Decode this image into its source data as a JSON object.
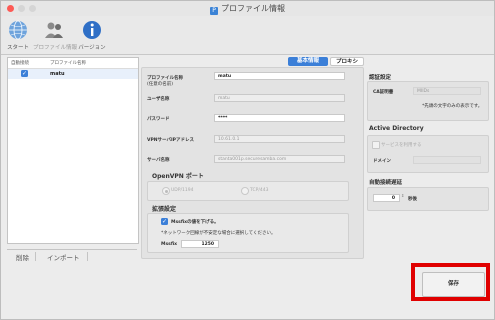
{
  "window": {
    "title": "プロファイル情報",
    "app_icon_glyph": "P",
    "traffic_lights": [
      "#fd5a55",
      "#d5d5d5",
      "#d5d5d5"
    ]
  },
  "toolbar": {
    "items": [
      {
        "label": "スタート",
        "icon": "globe-icon",
        "disabled": false
      },
      {
        "label": "プロファイル情報",
        "icon": "users-icon",
        "disabled": true
      },
      {
        "label": "バージョン",
        "icon": "info-icon",
        "disabled": false
      }
    ]
  },
  "profile_list": {
    "headers": {
      "default": "自動接続",
      "name": "プロファイル名称"
    },
    "rows": [
      {
        "default_checked": true,
        "name": "matu"
      }
    ]
  },
  "list_buttons": {
    "delete": "削除",
    "import": "インポート"
  },
  "tabs": {
    "basic": "基本情報",
    "proxy": "プロキシ",
    "active": "basic"
  },
  "form": {
    "profile_name": {
      "label": "プロファイル名称",
      "sublabel": "(任意の名前)",
      "value": "matu"
    },
    "username": {
      "label": "ユーザ名称",
      "value": "matu"
    },
    "password": {
      "label": "パスワード",
      "value": "****"
    },
    "vpn_server": {
      "label": "VPNサーバIPアドレス",
      "value": "10.61.0.1"
    },
    "server_name": {
      "label": "サーバ名称",
      "value": "stanta001p.securesamba.com"
    },
    "openvpn_port": {
      "title": "OpenVPN ポート",
      "options": [
        {
          "label": "UDP/1194",
          "selected": true
        },
        {
          "label": "TCP/443",
          "selected": false
        }
      ]
    },
    "extended": {
      "title": "拡張設定",
      "mssfix_checkbox": "Mssfixの値を下げる。",
      "note": "*ネットワーク回線が不安定な場合に選択してください。",
      "mssfix_label": "Mssfix",
      "mssfix_value": "1250"
    }
  },
  "cert": {
    "title": "認証設定",
    "ca_label": "CA証明書",
    "ca_value": "MIIDs",
    "ca_note": "*先頭の文字のみの表示です。"
  },
  "active_directory": {
    "title": "Active Directory",
    "checkbox_label": "サービスを利用する",
    "domain_label": "ドメイン",
    "domain_value": ""
  },
  "auto_reconnect": {
    "title": "自動接続遅延",
    "value": "0",
    "unit": "秒後"
  },
  "save_button": "保存",
  "colors": {
    "accent": "#3b7fd8",
    "highlight": "#e00000"
  }
}
